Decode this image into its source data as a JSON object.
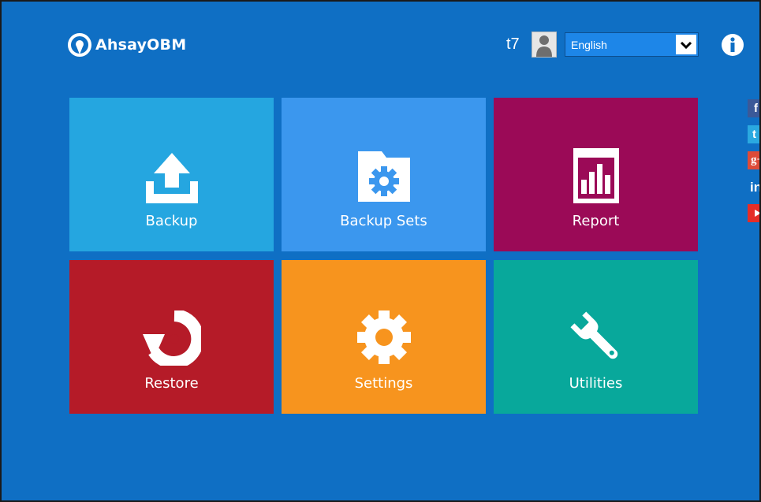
{
  "app": {
    "name": "AhsayOBM"
  },
  "header": {
    "username": "t7",
    "language": {
      "selected": "English"
    },
    "icons": {
      "avatar": "user-avatar-icon",
      "info": "info-icon",
      "dropdown": "chevron-down-icon"
    }
  },
  "tiles": [
    {
      "label": "Backup",
      "icon": "upload-icon",
      "color": "#25a6e0"
    },
    {
      "label": "Backup Sets",
      "icon": "folder-gear-icon",
      "color": "#3b97ee"
    },
    {
      "label": "Report",
      "icon": "bar-chart-icon",
      "color": "#9b0a57"
    },
    {
      "label": "Restore",
      "icon": "restore-arrow-icon",
      "color": "#b51b28"
    },
    {
      "label": "Settings",
      "icon": "gear-icon",
      "color": "#f7941e"
    },
    {
      "label": "Utilities",
      "icon": "wrench-icon",
      "color": "#08a89b"
    }
  ],
  "social": [
    {
      "name": "facebook",
      "glyph": "f"
    },
    {
      "name": "twitter",
      "glyph": "t"
    },
    {
      "name": "google-plus",
      "glyph": "g+"
    },
    {
      "name": "linkedin",
      "glyph": "in"
    },
    {
      "name": "youtube",
      "glyph": ""
    }
  ],
  "colors": {
    "background": "#0f6fc4",
    "accent": "#1d86e8"
  }
}
